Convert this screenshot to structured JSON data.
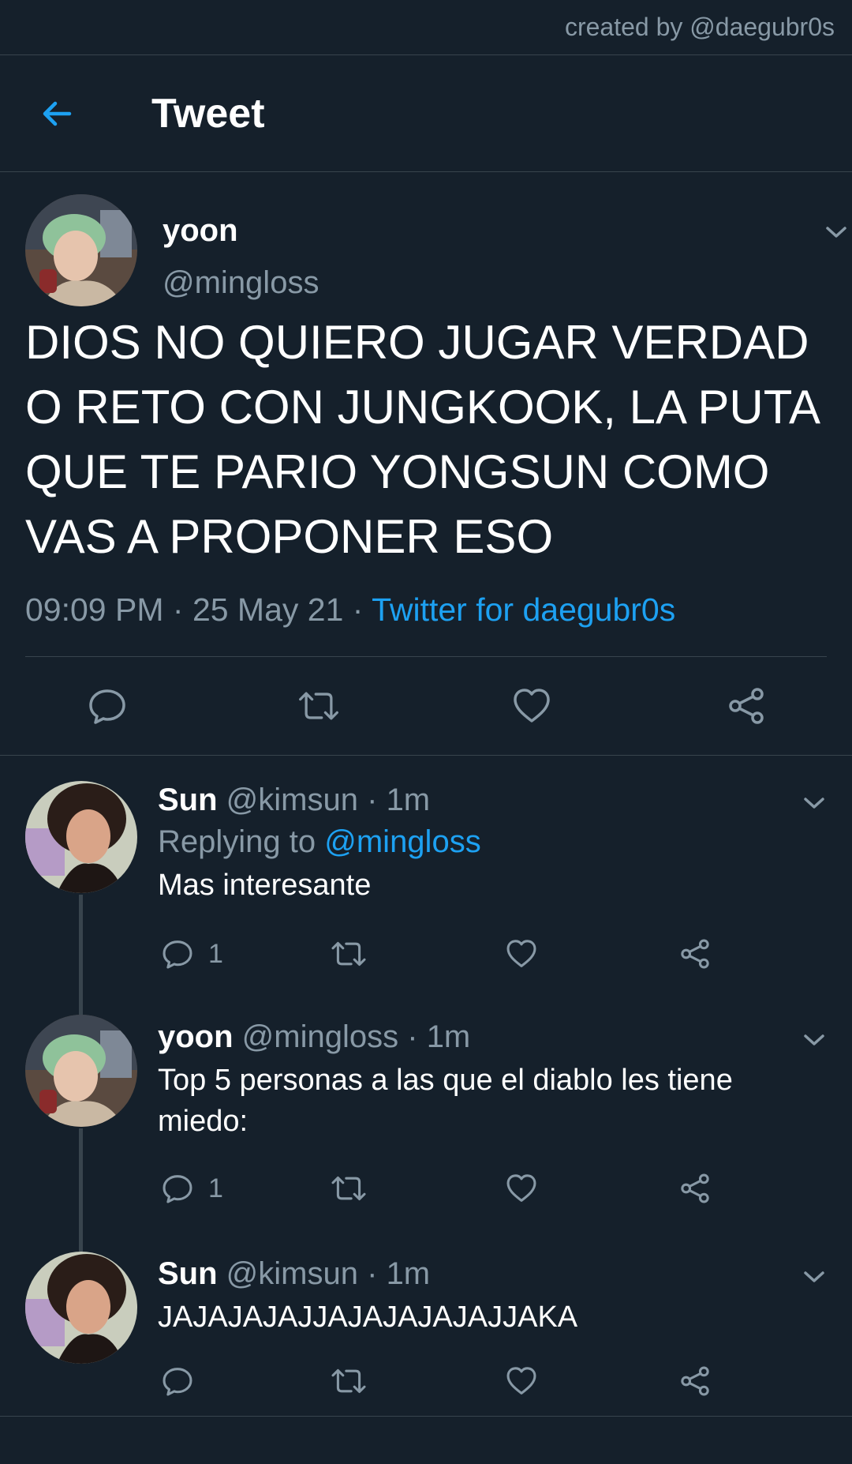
{
  "credit": "created by @daegubr0s",
  "header": {
    "title": "Tweet"
  },
  "main_tweet": {
    "name": "yoon",
    "handle": "@mingloss",
    "text": "DIOS NO QUIERO JUGAR VERDAD O RETO CON JUNGKOOK, LA PUTA QUE TE PARIO YONGSUN COMO VAS A PROPONER ESO",
    "time": "09:09 PM",
    "date": "25 May 21",
    "source": "Twitter for daegubr0s",
    "sep": " · "
  },
  "replies": [
    {
      "name": "Sun",
      "handle": "@kimsun",
      "time": "1m",
      "replying_prefix": "Replying to",
      "replying_to": "@mingloss",
      "text": "Mas interesante",
      "reply_count": "1"
    },
    {
      "name": "yoon",
      "handle": "@mingloss",
      "time": "1m",
      "text": "Top 5 personas a las que el diablo les tiene miedo:",
      "reply_count": "1"
    },
    {
      "name": "Sun",
      "handle": "@kimsun",
      "time": "1m",
      "text": "JAJAJAJAJJAJAJAJAJAJJAKA",
      "reply_count": ""
    }
  ],
  "colors": {
    "bg": "#15202b",
    "accent": "#1da1f2",
    "muted": "#8899a6",
    "border": "#38444d"
  },
  "icons": [
    "back-arrow-icon",
    "chevron-down-icon",
    "reply-icon",
    "retweet-icon",
    "like-icon",
    "share-icon"
  ]
}
